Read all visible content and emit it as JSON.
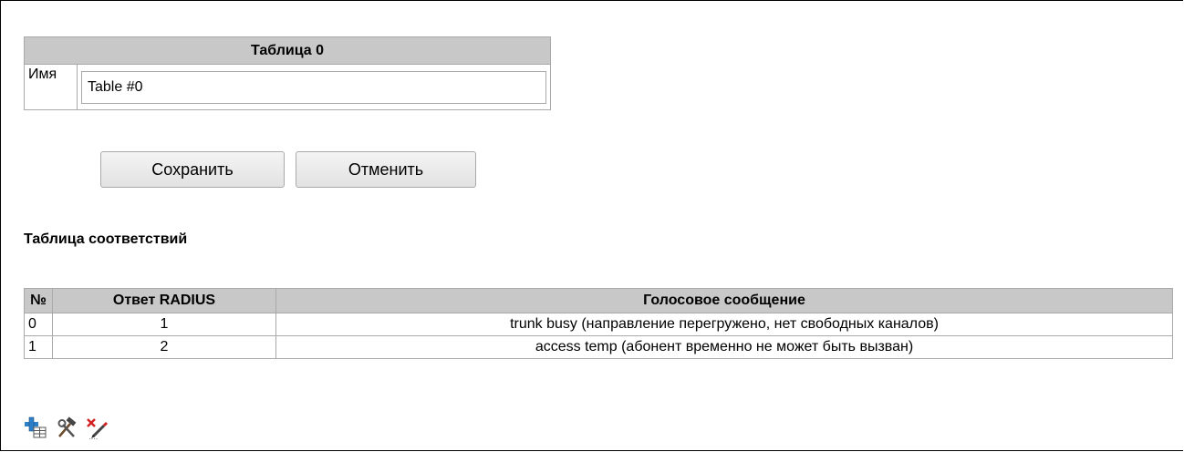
{
  "form": {
    "header": "Таблица 0",
    "name_label": "Имя",
    "name_value": "Table #0"
  },
  "buttons": {
    "save_label": "Сохранить",
    "cancel_label": "Отменить"
  },
  "mapping": {
    "title": "Таблица соответствий",
    "columns": [
      "№",
      "Ответ RADIUS",
      "Голосовое сообщение"
    ],
    "rows": [
      {
        "num": "0",
        "radius": "1",
        "message": "trunk busy (направление перегружено, нет свободных каналов)"
      },
      {
        "num": "1",
        "radius": "2",
        "message": "access temp (абонент временно не может быть вызван)"
      }
    ]
  },
  "toolbar": {
    "icons": [
      "add-row-icon",
      "edit-tools-icon",
      "delete-edit-icon"
    ]
  },
  "colors": {
    "header_bg": "#c8c8c8",
    "border": "#a9a9a9",
    "add_icon": "#2d7fc8",
    "delete_icon": "#d22222"
  }
}
